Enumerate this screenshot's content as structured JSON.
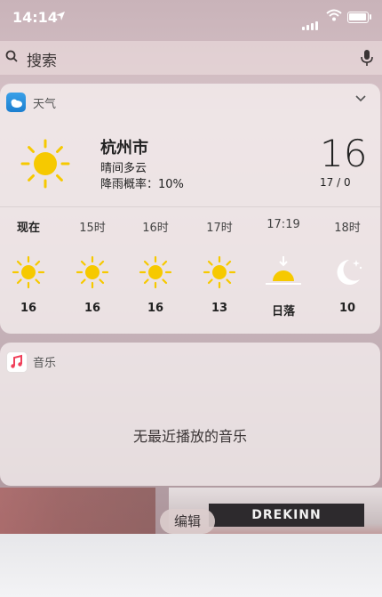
{
  "status_bar": {
    "time": "14:14"
  },
  "search": {
    "placeholder": "搜索"
  },
  "weather": {
    "app_title": "天气",
    "city": "杭州市",
    "condition": "晴间多云",
    "rain_label": "降雨概率：10%",
    "temperature": "16",
    "hi_lo": "17 / 0",
    "hours": [
      {
        "label": "现在",
        "icon": "sun-icon",
        "temp": "16"
      },
      {
        "label": "15时",
        "icon": "sun-icon",
        "temp": "16"
      },
      {
        "label": "16时",
        "icon": "sun-icon",
        "temp": "16"
      },
      {
        "label": "17时",
        "icon": "sun-icon",
        "temp": "13"
      },
      {
        "label": "17:19",
        "icon": "sunset-icon",
        "temp": "日落"
      },
      {
        "label": "18时",
        "icon": "moon-stars-icon",
        "temp": "10"
      }
    ]
  },
  "music": {
    "app_title": "音乐",
    "empty_text": "无最近播放的音乐"
  },
  "edit_button": {
    "label": "编辑"
  },
  "background": {
    "sign": "DREKINN"
  },
  "colors": {
    "sun": "#f6c900",
    "weather_app": "#1c7fd0"
  }
}
